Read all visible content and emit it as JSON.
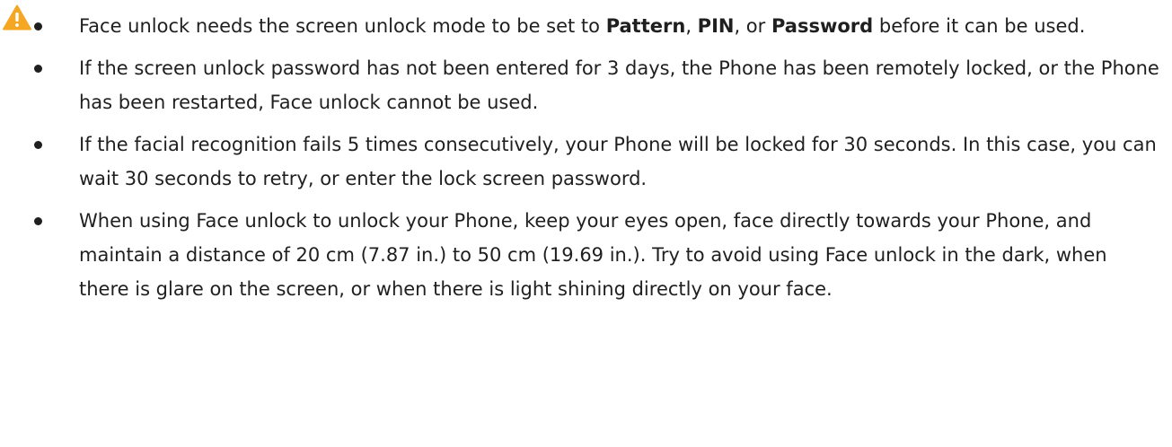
{
  "colors": {
    "warning_icon": "#f5a623",
    "text": "#1f1f1f"
  },
  "icon": "warning-triangle-icon",
  "items": [
    {
      "t1": "Face unlock needs the screen unlock mode to be set to ",
      "b1": "Pattern",
      "t2": ", ",
      "b2": "PIN",
      "t3": ", or ",
      "b3": "Password",
      "t4": " before it can be used."
    },
    {
      "text": "If the screen unlock password has not been entered for 3 days, the Phone has been remotely locked, or the Phone has been restarted, Face unlock cannot be used."
    },
    {
      "text": "If the facial recognition fails 5 times consecutively, your Phone will be locked for 30 seconds. In this case, you can wait 30 seconds to retry, or enter the lock screen password."
    },
    {
      "text": "When using Face unlock to unlock your Phone, keep your eyes open, face directly towards your Phone, and maintain a distance of 20 cm (7.87 in.) to 50 cm (19.69 in.). Try to avoid using Face unlock in the dark, when there is glare on the screen, or when there is light shining directly on your face."
    }
  ]
}
